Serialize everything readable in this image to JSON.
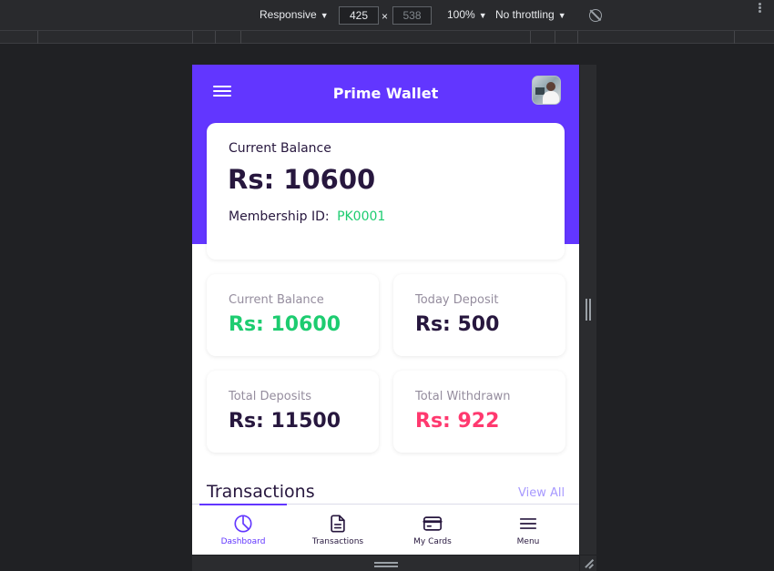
{
  "devtools": {
    "device_mode": "Responsive",
    "width": "425",
    "times": "×",
    "height": "538",
    "zoom": "100%",
    "throttling": "No throttling"
  },
  "app": {
    "title": "Prime Wallet",
    "accent_color": "#6236ff",
    "balance_card": {
      "label": "Current Balance",
      "amount": "Rs: 10600",
      "membership_label": "Membership ID:",
      "membership_id": "PK0001"
    },
    "stats": [
      {
        "label": "Current Balance",
        "value": "Rs: 10600",
        "color": "#1dcc70"
      },
      {
        "label": "Today Deposit",
        "value": "Rs: 500",
        "color": "#27173e"
      },
      {
        "label": "Total Deposits",
        "value": "Rs: 11500",
        "color": "#27173e"
      },
      {
        "label": "Total Withdrawn",
        "value": "Rs: 922",
        "color": "#ff396f"
      }
    ],
    "transactions": {
      "title": "Transactions",
      "view_all": "View All"
    },
    "bottom_nav": [
      {
        "label": "Dashboard",
        "icon": "pie-chart-icon",
        "active": true
      },
      {
        "label": "Transactions",
        "icon": "document-icon",
        "active": false
      },
      {
        "label": "My Cards",
        "icon": "credit-card-icon",
        "active": false
      },
      {
        "label": "Menu",
        "icon": "menu-icon",
        "active": false
      }
    ]
  }
}
